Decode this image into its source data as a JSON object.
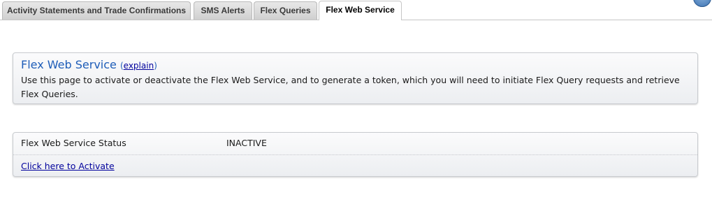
{
  "tabs": [
    {
      "label": "Activity Statements and Trade Confirmations",
      "active": false
    },
    {
      "label": "SMS Alerts",
      "active": false
    },
    {
      "label": "Flex Queries",
      "active": false
    },
    {
      "label": "Flex Web Service",
      "active": true
    }
  ],
  "help_icon": "help-icon",
  "info": {
    "title": "Flex Web Service",
    "paren_open": "(",
    "explain_link": "explain",
    "paren_close": ")",
    "description": "Use this page to activate or deactivate the Flex Web Service, and to generate a token, which you will need to initiate Flex Query requests and retrieve Flex Queries."
  },
  "status": {
    "label": "Flex Web Service Status",
    "value": "INACTIVE",
    "activate_link": "Click here to Activate"
  },
  "colors": {
    "title": "#1e5db8",
    "link": "#00009c",
    "panel_border": "#c9ccd0"
  }
}
